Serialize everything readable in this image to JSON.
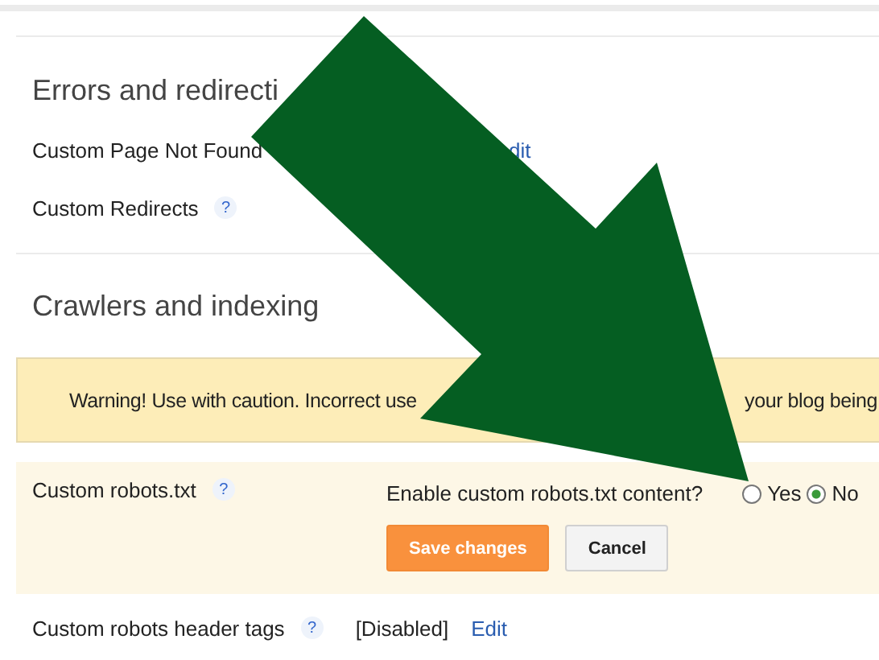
{
  "errors": {
    "title": "Errors and redirecti",
    "rows": [
      {
        "label": "Custom Page Not Found",
        "link": "dit"
      },
      {
        "label": "Custom Redirects",
        "help": "?"
      }
    ]
  },
  "crawlers": {
    "title": "Crawlers and indexing",
    "warning": [
      "Warning! Use with caution. Incorrect use",
      "your blog being"
    ],
    "robots_txt": {
      "label": "Custom robots.txt",
      "help": "?",
      "question": "Enable custom robots.txt content?",
      "options": [
        {
          "label": "Yes",
          "selected": false
        },
        {
          "label": "No",
          "selected": true
        }
      ],
      "buttons": [
        {
          "label": "Save changes",
          "kind": "primary"
        },
        {
          "label": "Cancel",
          "kind": "secondary"
        }
      ]
    },
    "header_tags": {
      "label": "Custom robots header tags",
      "help": "?",
      "value": "[Disabled]",
      "link": "Edit"
    }
  }
}
